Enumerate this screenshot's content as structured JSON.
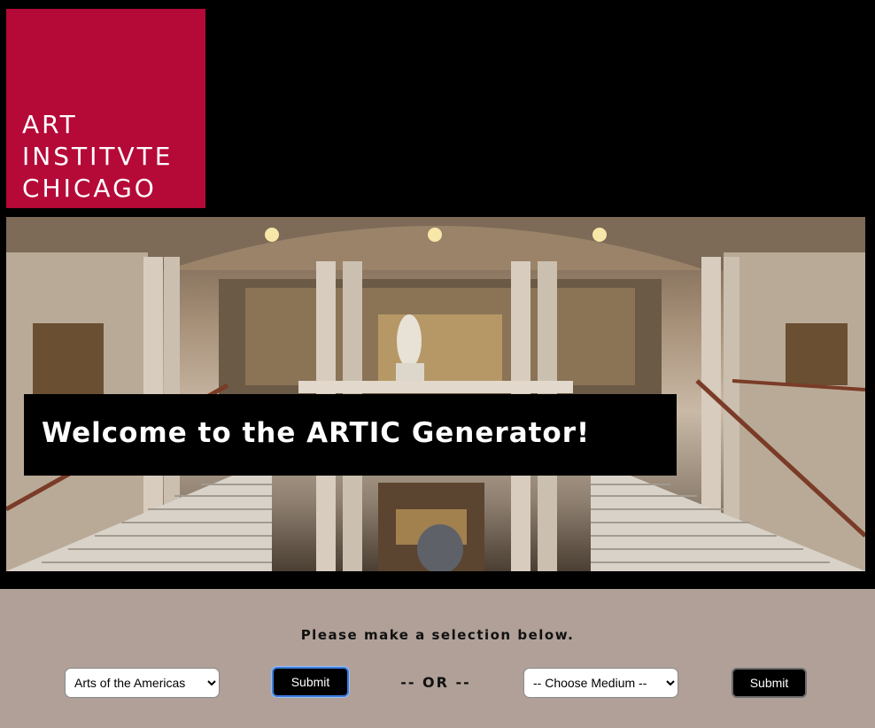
{
  "logo": {
    "lines": [
      "ART",
      "INSTITVTE",
      "CHICAGO"
    ]
  },
  "hero": {
    "title": "Welcome to the ARTIC Generator!"
  },
  "selection": {
    "prompt": "Please make a selection below.",
    "department_selected": "Arts of the Americas",
    "department_submit": "Submit",
    "separator": "-- OR --",
    "medium_selected": "-- Choose Medium --",
    "medium_submit": "Submit"
  },
  "colors": {
    "logo_bg": "#b50938",
    "page_bg": "#000000",
    "panel_bg": "#b0a098",
    "button_bg": "#000000"
  }
}
